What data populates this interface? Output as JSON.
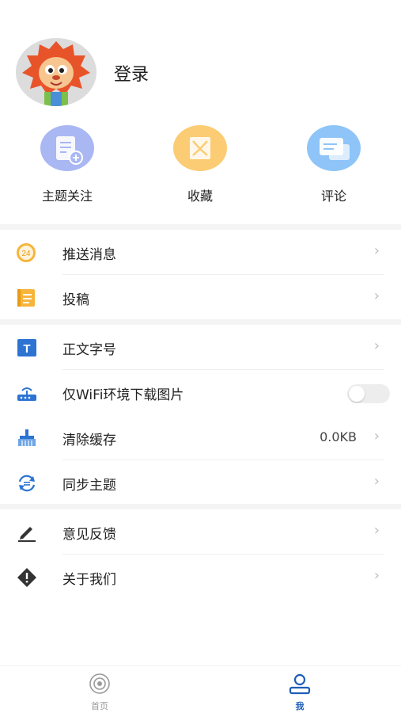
{
  "profile": {
    "login_label": "登录"
  },
  "shortcuts": [
    {
      "label": "主题关注",
      "icon": "topic-follow-icon",
      "color": "#a9b7f3"
    },
    {
      "label": "收藏",
      "icon": "favorites-icon",
      "color": "#fbcc74"
    },
    {
      "label": "评论",
      "icon": "comments-icon",
      "color": "#8ec4f7"
    }
  ],
  "menu": {
    "push": {
      "label": "推送消息",
      "icon": "push-badge-icon"
    },
    "submit": {
      "label": "投稿",
      "icon": "submit-document-icon"
    },
    "font_size": {
      "label": "正文字号",
      "icon": "font-size-icon"
    },
    "wifi_only": {
      "label": "仅WiFi环境下载图片",
      "icon": "router-icon",
      "enabled": false
    },
    "clear_cache": {
      "label": "清除缓存",
      "value": "0.0KB",
      "icon": "broom-icon"
    },
    "sync": {
      "label": "同步主题",
      "icon": "sync-icon"
    },
    "feedback": {
      "label": "意见反馈",
      "icon": "pencil-icon"
    },
    "about": {
      "label": "关于我们",
      "icon": "diamond-alert-icon"
    }
  },
  "tabbar": {
    "home": {
      "label": "首页",
      "active": false
    },
    "me": {
      "label": "我",
      "active": true
    }
  },
  "colors": {
    "accent": "#1e5db8",
    "inactive": "#999999",
    "chevron": "#bdbdbd"
  }
}
